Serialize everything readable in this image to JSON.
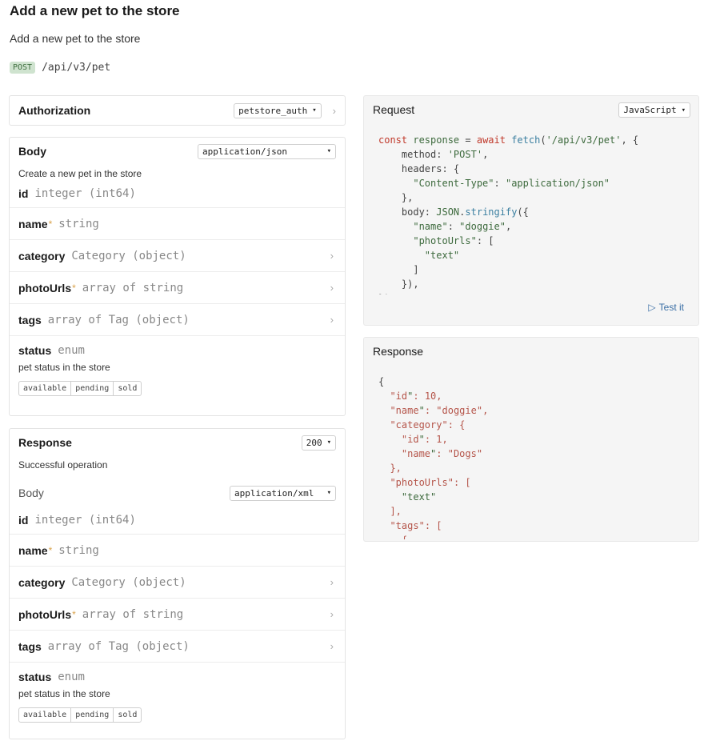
{
  "page": {
    "title": "Add a new pet to the store",
    "description": "Add a new pet to the store",
    "method": "POST",
    "path": "/api/v3/pet"
  },
  "authorization": {
    "title": "Authorization",
    "selected": "petstore_auth"
  },
  "body": {
    "title": "Body",
    "content_type": "application/json",
    "description": "Create a new pet in the store",
    "properties": [
      {
        "name": "id",
        "required": false,
        "type": "integer (int64)"
      },
      {
        "name": "name",
        "required": true,
        "type": "string"
      },
      {
        "name": "category",
        "required": false,
        "type": "Category (object)"
      },
      {
        "name": "photoUrls",
        "required": true,
        "type": "array of string"
      },
      {
        "name": "tags",
        "required": false,
        "type": "array of Tag (object)"
      }
    ],
    "status": {
      "name": "status",
      "type": "enum",
      "description": "pet status in the store",
      "values": [
        "available",
        "pending",
        "sold"
      ]
    }
  },
  "response": {
    "title": "Response",
    "status_code": "200",
    "description": "Successful operation",
    "body_label": "Body",
    "content_type": "application/xml",
    "properties": [
      {
        "name": "id",
        "required": false,
        "type": "integer (int64)"
      },
      {
        "name": "name",
        "required": true,
        "type": "string"
      },
      {
        "name": "category",
        "required": false,
        "type": "Category (object)"
      },
      {
        "name": "photoUrls",
        "required": true,
        "type": "array of string"
      },
      {
        "name": "tags",
        "required": false,
        "type": "array of Tag (object)"
      }
    ],
    "status": {
      "name": "status",
      "type": "enum",
      "description": "pet status in the store",
      "values": [
        "available",
        "pending",
        "sold"
      ]
    }
  },
  "request_panel": {
    "title": "Request",
    "language": "JavaScript",
    "test_label": "Test it",
    "code_lines": [
      "const response = await fetch('/api/v3/pet', {",
      "    method: 'POST',",
      "    headers: {",
      "      \"Content-Type\": \"application/json\"",
      "    },",
      "    body: JSON.stringify({",
      "      \"name\": \"doggie\",",
      "      \"photoUrls\": [",
      "        \"text\"",
      "      ]",
      "    }),",
      "});"
    ]
  },
  "response_panel": {
    "title": "Response",
    "code_lines": [
      "{",
      "  \"id\": 10,",
      "  \"name\": \"doggie\",",
      "  \"category\": {",
      "    \"id\": 1,",
      "    \"name\": \"Dogs\"",
      "  },",
      "  \"photoUrls\": [",
      "    \"text\"",
      "  ],",
      "  \"tags\": [",
      "    {"
    ]
  },
  "icons": {
    "chevron_down": "chevron-down-icon",
    "chevron_right": "chevron-right-icon",
    "play": "play-icon"
  }
}
